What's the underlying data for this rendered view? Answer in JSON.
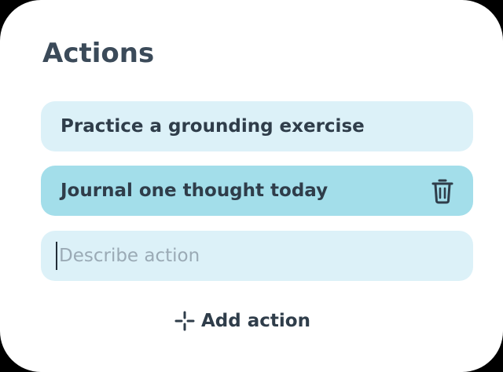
{
  "card": {
    "title": "Actions"
  },
  "actions": {
    "items": [
      {
        "label": "Practice a grounding exercise",
        "selected": false
      },
      {
        "label": "Journal one thought today",
        "selected": true,
        "delete_icon": "trash-icon"
      }
    ],
    "new_action": {
      "value": "",
      "placeholder": "Describe action"
    },
    "add_label": "Add action",
    "add_icon": "sparkle-plus-icon"
  },
  "colors": {
    "card_background": "#ffffff",
    "item_background": "#dcf1f8",
    "selected_item_background": "#a3deea",
    "text": "#2f3d4a",
    "title": "#3b4a59",
    "placeholder": "#9aaab5"
  }
}
